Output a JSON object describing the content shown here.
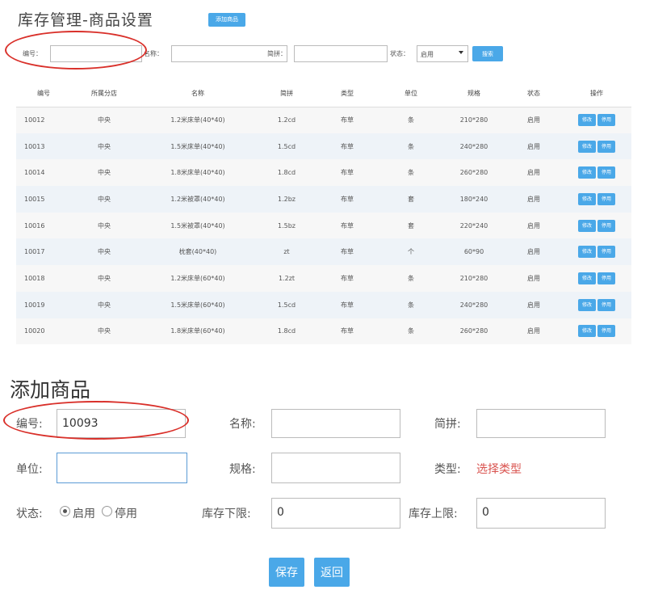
{
  "header": {
    "title": "库存管理-商品设置",
    "add_button": "添加商品"
  },
  "filters": {
    "id_label": "编号：",
    "name_label": "名称：",
    "pinyin_label": "简拼：",
    "status_label": "状态：",
    "status_selected": "启用",
    "search_button": "搜索"
  },
  "table": {
    "columns": [
      "编号",
      "所属分店",
      "名称",
      "简拼",
      "类型",
      "单位",
      "规格",
      "状态",
      "操作"
    ],
    "rows": [
      {
        "id": "10012",
        "branch": "中央",
        "name": "1.2米床单(40*40)",
        "pinyin": "1.2cd",
        "type": "布草",
        "unit": "条",
        "spec": "210*280",
        "status": "启用"
      },
      {
        "id": "10013",
        "branch": "中央",
        "name": "1.5米床单(40*40)",
        "pinyin": "1.5cd",
        "type": "布草",
        "unit": "条",
        "spec": "240*280",
        "status": "启用"
      },
      {
        "id": "10014",
        "branch": "中央",
        "name": "1.8米床单(40*40)",
        "pinyin": "1.8cd",
        "type": "布草",
        "unit": "条",
        "spec": "260*280",
        "status": "启用"
      },
      {
        "id": "10015",
        "branch": "中央",
        "name": "1.2米被罩(40*40)",
        "pinyin": "1.2bz",
        "type": "布草",
        "unit": "套",
        "spec": "180*240",
        "status": "启用"
      },
      {
        "id": "10016",
        "branch": "中央",
        "name": "1.5米被罩(40*40)",
        "pinyin": "1.5bz",
        "type": "布草",
        "unit": "套",
        "spec": "220*240",
        "status": "启用"
      },
      {
        "id": "10017",
        "branch": "中央",
        "name": "枕套(40*40)",
        "pinyin": "zt",
        "type": "布草",
        "unit": "个",
        "spec": "60*90",
        "status": "启用"
      },
      {
        "id": "10018",
        "branch": "中央",
        "name": "1.2米床单(60*40)",
        "pinyin": "1.2zt",
        "type": "布草",
        "unit": "条",
        "spec": "210*280",
        "status": "启用"
      },
      {
        "id": "10019",
        "branch": "中央",
        "name": "1.5米床单(60*40)",
        "pinyin": "1.5cd",
        "type": "布草",
        "unit": "条",
        "spec": "240*280",
        "status": "启用"
      },
      {
        "id": "10020",
        "branch": "中央",
        "name": "1.8米床单(60*40)",
        "pinyin": "1.8cd",
        "type": "布草",
        "unit": "条",
        "spec": "260*280",
        "status": "启用"
      }
    ],
    "edit_button": "修改",
    "disable_button": "停用"
  },
  "form": {
    "title": "添加商品",
    "id_label": "编号:",
    "id_value": "10093",
    "name_label": "名称:",
    "pinyin_label": "简拼:",
    "unit_label": "单位:",
    "spec_label": "规格:",
    "type_label": "类型:",
    "type_value": "选择类型",
    "status_label": "状态:",
    "status_enabled": "启用",
    "status_disabled": "停用",
    "stock_min_label": "库存下限:",
    "stock_min_value": "0",
    "stock_max_label": "库存上限:",
    "stock_max_value": "0",
    "save_button": "保存",
    "back_button": "返回"
  },
  "colors": {
    "accent": "#4aa8e8",
    "annotation": "#d9302a",
    "type_link": "#d9534f"
  }
}
